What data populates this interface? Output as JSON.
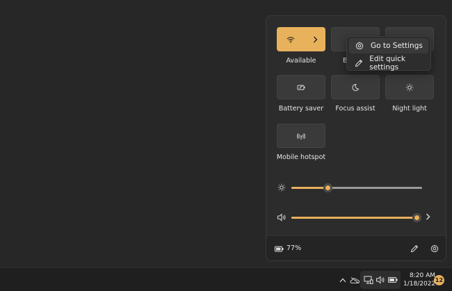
{
  "accent_color": "#e8b15c",
  "quick_settings": {
    "tiles": [
      {
        "label": "Available",
        "icon": "wifi-icon",
        "active": true,
        "has_chevron": true
      },
      {
        "label": "B",
        "icon": "bluetooth-icon",
        "active": false
      },
      {
        "label": "",
        "icon": "airplane-icon",
        "active": false
      },
      {
        "label": "Battery saver",
        "icon": "battery-saver-icon",
        "active": false
      },
      {
        "label": "Focus assist",
        "icon": "moon-icon",
        "active": false
      },
      {
        "label": "Night light",
        "icon": "brightness-icon",
        "active": false
      },
      {
        "label": "Mobile hotspot",
        "icon": "hotspot-icon",
        "active": false
      }
    ],
    "brightness": {
      "icon": "brightness-icon",
      "level": 0.28
    },
    "volume": {
      "icon": "speaker-icon",
      "level": 0.99
    },
    "footer": {
      "battery_text": "77%",
      "edit_icon": "pencil-icon",
      "settings_icon": "gear-icon"
    }
  },
  "context_menu": {
    "items": [
      {
        "label": "Go to Settings",
        "icon": "gear-icon"
      },
      {
        "label": "Edit quick settings",
        "icon": "pencil-icon"
      }
    ]
  },
  "taskbar": {
    "time": "8:20 AM",
    "date": "1/18/2022",
    "notification_count": "12",
    "tray_icons": [
      "chevron-up-icon",
      "onedrive-icon",
      "network-icon",
      "speaker-icon",
      "battery-icon"
    ]
  }
}
